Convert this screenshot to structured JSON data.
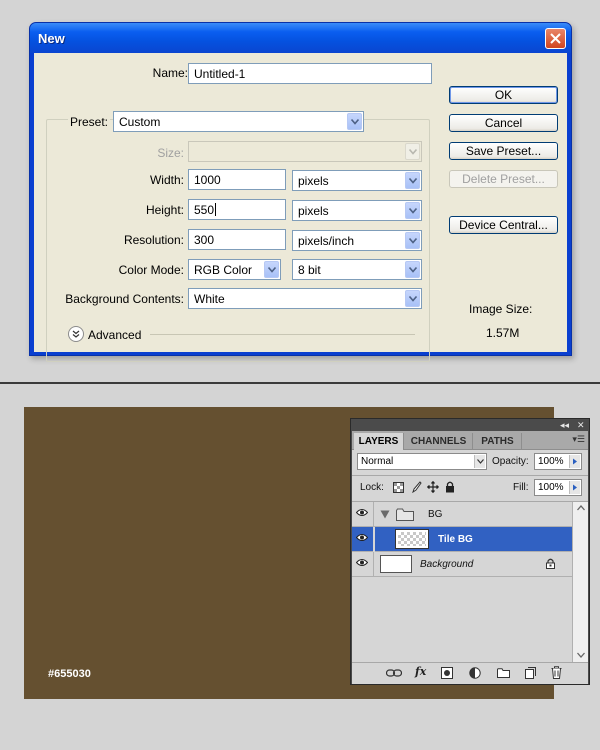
{
  "dialog": {
    "title": "New",
    "name_label": "Name:",
    "name_value": "Untitled-1",
    "preset_label": "Preset:",
    "preset_value": "Custom",
    "size_label": "Size:",
    "width_label": "Width:",
    "width_value": "1000",
    "width_unit": "pixels",
    "height_label": "Height:",
    "height_value": "550",
    "height_unit": "pixels",
    "resolution_label": "Resolution:",
    "resolution_value": "300",
    "resolution_unit": "pixels/inch",
    "colormode_label": "Color Mode:",
    "colormode_value": "RGB Color",
    "bitdepth_value": "8 bit",
    "bg_label": "Background Contents:",
    "bg_value": "White",
    "advanced_label": "Advanced",
    "buttons": {
      "ok": "OK",
      "cancel": "Cancel",
      "save_preset": "Save Preset...",
      "delete_preset": "Delete Preset...",
      "device_central": "Device Central..."
    },
    "image_size_label": "Image Size:",
    "image_size_value": "1.57M"
  },
  "canvas": {
    "color": "#655030",
    "hex_label": "#655030"
  },
  "layers_panel": {
    "tabs": [
      "LAYERS",
      "CHANNELS",
      "PATHS"
    ],
    "blend_mode": "Normal",
    "opacity_label": "Opacity:",
    "opacity_value": "100%",
    "lock_label": "Lock:",
    "fill_label": "Fill:",
    "fill_value": "100%",
    "layers": [
      {
        "name": "BG",
        "type": "group"
      },
      {
        "name": "Tile BG",
        "type": "layer",
        "selected": true
      },
      {
        "name": "Background",
        "type": "background",
        "locked": true
      }
    ]
  },
  "colors": {
    "xp_title_blue": "#0a5ef0",
    "selected_layer": "#3161c2"
  }
}
